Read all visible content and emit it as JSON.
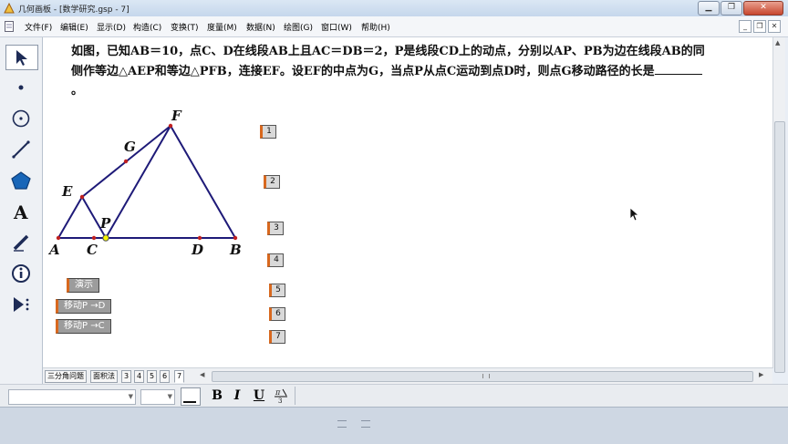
{
  "window": {
    "title": "几何画板 - [数学研究.gsp - 7]"
  },
  "menu": {
    "items": [
      "文件(F)",
      "编辑(E)",
      "显示(D)",
      "构造(C)",
      "变换(T)",
      "度量(M)",
      "数据(N)",
      "绘图(G)",
      "窗口(W)",
      "帮助(H)"
    ]
  },
  "problem": {
    "text": "如图，已知AB＝10，点C、D在线段AB上且AC＝DB＝2，P是线段CD上的动点，分别以AP、PB为边在线段AB的同侧作等边△AEP和等边△PFB，连接EF。设EF的中点为G，当点P从点C运动到点D时，则点G移动路径的长是",
    "end": "。"
  },
  "figure": {
    "points": {
      "A": "A",
      "C": "C",
      "P": "P",
      "D": "D",
      "B": "B",
      "E": "E",
      "F": "F",
      "G": "G"
    },
    "line_color": "#1e1a78",
    "moving_point_color": "#f4f400"
  },
  "page_buttons": [
    "1",
    "2",
    "3",
    "4",
    "5",
    "6",
    "7"
  ],
  "action_buttons": {
    "demo": "演示",
    "move_to_d": "移动P →D",
    "move_to_c": "移动P →C"
  },
  "tabs": [
    "三分角问题",
    "面积法",
    "3",
    "4",
    "5",
    "6",
    "7"
  ],
  "active_tab_index": 6,
  "format_bar": {
    "bold": "B",
    "italic": "I",
    "underline": "U"
  },
  "colors": {
    "accent_orange": "#d8681e",
    "button_gray": "#9c9c9c"
  }
}
